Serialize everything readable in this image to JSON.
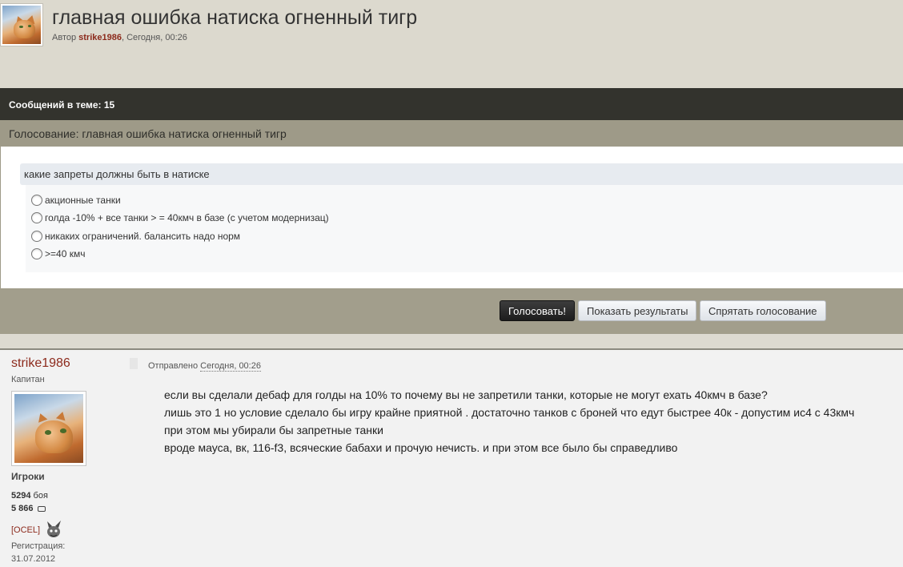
{
  "topic": {
    "title": "главная ошибка натиска огненный тигр",
    "meta_prefix": "Автор ",
    "author": "strike1986",
    "meta_suffix": ", Сегодня, 00:26"
  },
  "count_bar": {
    "text": "Сообщений в теме: 15"
  },
  "poll": {
    "header": "Голосование: главная ошибка натиска огненный тигр",
    "question": "какие запреты должны быть в натиске",
    "options": [
      "акционные танки",
      "голда -10% + все танки > = 40кмч в базе (с учетом модернизац)",
      "никаких ограничений. балансить надо норм",
      ">=40 кмч"
    ],
    "buttons": {
      "vote": "Голосовать!",
      "results": "Показать результаты",
      "hide": "Спрятать голосование"
    }
  },
  "post": {
    "author": "strike1986",
    "rank": "Капитан",
    "group": "Игроки",
    "battles_value": "5294",
    "battles_label": " боя",
    "posts_value": "5 866",
    "clan": "[OCEL]",
    "reg_label": "Регистрация:",
    "reg_date": "31.07.2012",
    "posted_prefix": "Отправлено ",
    "posted_date": "Сегодня, 00:26",
    "lines": [
      "если вы сделали дебаф для голды на 10%  то почему вы не запретили танки, которые не могут ехать 40кмч в базе?",
      "лишь это 1 но условие сделало бы игру крайне приятной . достаточно танков с броней что едут быстрее 40к - допустим ис4  с 43кмч",
      "при этом мы убирали бы запретные танки",
      "вроде мауса, вк, 116-f3,  всяческие бабахи и прочую нечисть. и при этом все было бы справедливо"
    ]
  },
  "colors": {
    "accent_red": "#8c2a1c",
    "dark_bar": "#33332d",
    "poll_header": "#9e9a88",
    "question_bg": "#e7ebf0"
  },
  "icons": [
    "avatar-cat-image",
    "radio-icon",
    "comment-icon",
    "clan-emblem-icon"
  ]
}
